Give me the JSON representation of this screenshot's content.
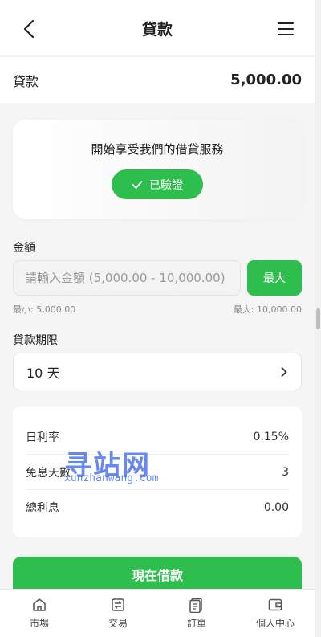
{
  "header": {
    "title": "貸款",
    "back_icon": "chevron-left-icon",
    "menu_icon": "hamburger-menu-icon"
  },
  "balance": {
    "label": "貸款",
    "value": "5,000.00"
  },
  "verify": {
    "headline": "開始享受我們的借貸服務",
    "status_label": "已驗證",
    "status_icon": "checkmark-icon"
  },
  "amount": {
    "label": "金額",
    "placeholder": "請輸入金額 (5,000.00 - 10,000.00)",
    "value": "",
    "max_label": "最大",
    "min_text": "最小: 5,000.00",
    "max_text": "最大: 10,000.00"
  },
  "term": {
    "label": "貸款期限",
    "value": "10 天",
    "icon": "chevron-right-icon"
  },
  "summary": {
    "rows": [
      {
        "label": "日利率",
        "value": "0.15%"
      },
      {
        "label": "免息天數",
        "value": "3"
      },
      {
        "label": "總利息",
        "value": "0.00"
      }
    ]
  },
  "watermark": {
    "big": "寻站网",
    "small": "xunzhanwang.com"
  },
  "borrow_button": {
    "label": "現在借款"
  },
  "tabbar": {
    "items": [
      {
        "label": "市場",
        "icon": "home-icon"
      },
      {
        "label": "交易",
        "icon": "exchange-icon"
      },
      {
        "label": "訂單",
        "icon": "orders-icon"
      },
      {
        "label": "個人中心",
        "icon": "wallet-icon"
      }
    ]
  },
  "colors": {
    "accent": "#2dbe4e",
    "background": "#f5f5f5",
    "watermark": "#466eeb"
  }
}
